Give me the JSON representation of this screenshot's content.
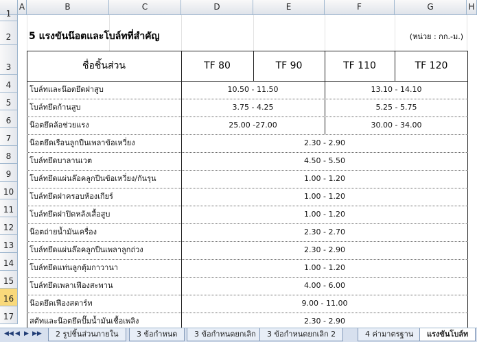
{
  "columns": [
    "A",
    "B",
    "C",
    "D",
    "E",
    "F",
    "G",
    "H"
  ],
  "rows": [
    "1",
    "2",
    "3",
    "4",
    "5",
    "6",
    "7",
    "8",
    "9",
    "10",
    "11",
    "12",
    "13",
    "14",
    "15",
    "16",
    "17"
  ],
  "title": "5  แรงขันน๊อตและโบล์ทที่สำคัญ",
  "unit": "(หน่วย : กก.-ม.)",
  "header": {
    "part": "ชื่อชิ้นส่วน",
    "tf80": "TF 80",
    "tf90": "TF 90",
    "tf110": "TF 110",
    "tf120": "TF 120"
  },
  "items": [
    {
      "name": "โบล์ทและน๊อตยึดฝาสูบ",
      "v1": "10.50 - 11.50",
      "v2": "13.10 - 14.10"
    },
    {
      "name": "โบล์ทยึดก้านสูบ",
      "v1": "3.75 - 4.25",
      "v2": "5.25 - 5.75"
    },
    {
      "name": "น๊อตยึดล้อช่วยแรง",
      "v1": "25.00 -27.00",
      "v2": "30.00 - 34.00"
    },
    {
      "name": "น๊อตยึดเรือนลูกปืนเพลาข้อเหวี่ยง",
      "v": "2.30 - 2.90"
    },
    {
      "name": "โบล์ทยึดบาลานเวต",
      "v": "4.50 - 5.50"
    },
    {
      "name": "โบล์ทยึดแผ่นล๊อคลูกปืนข้อเหวี่ยง/กันรุน",
      "v": "1.00 - 1.20"
    },
    {
      "name": "โบล์ทยึดฝาครอบห้องเกียร์",
      "v": "1.00 - 1.20"
    },
    {
      "name": "โบล์ทยึดฝาปิดหลังเสื้อสูบ",
      "v": "1.00 - 1.20"
    },
    {
      "name": "น๊อตถ่ายน้ำมันเครื่อง",
      "v": "2.30 - 2.70"
    },
    {
      "name": "โบล์ทยึดแผ่นล๊อคลูกปืนเพลาลูกถ่วง",
      "v": "2.30 - 2.90"
    },
    {
      "name": "โบล์ทยึดแท่นลูกตุ้มกาวานา",
      "v": "1.00 - 1.20"
    },
    {
      "name": "โบล์ทยึดเพลาเฟืองสะพาน",
      "v": "4.00 - 6.00"
    },
    {
      "name": "น๊อตยึดเฟืองสตาร์ท",
      "v": "9.00 - 11.00"
    },
    {
      "name": "สตัทและน๊อตยึดปั๊มน้ำมันเชื้อเพลิง",
      "v": "2.30 - 2.90"
    }
  ],
  "tabs": [
    "2 รูปชิ้นส่วนภายใน",
    "3 ข้อกำหนด",
    "3 ข้อกำหนดยกเลิก",
    "3 ข้อกำหนดยกเลิก 2",
    "4 ค่ามาตรฐาน",
    "แรงขันโบล์ท"
  ],
  "nav": [
    "◀◀",
    "◀",
    "▶",
    "▶▶"
  ],
  "colors": {
    "header_bg": "#dfe3ea",
    "active_row": "#f9d97b",
    "grid": "#e3e3e3",
    "tab_bar": "#d7e0ee"
  }
}
